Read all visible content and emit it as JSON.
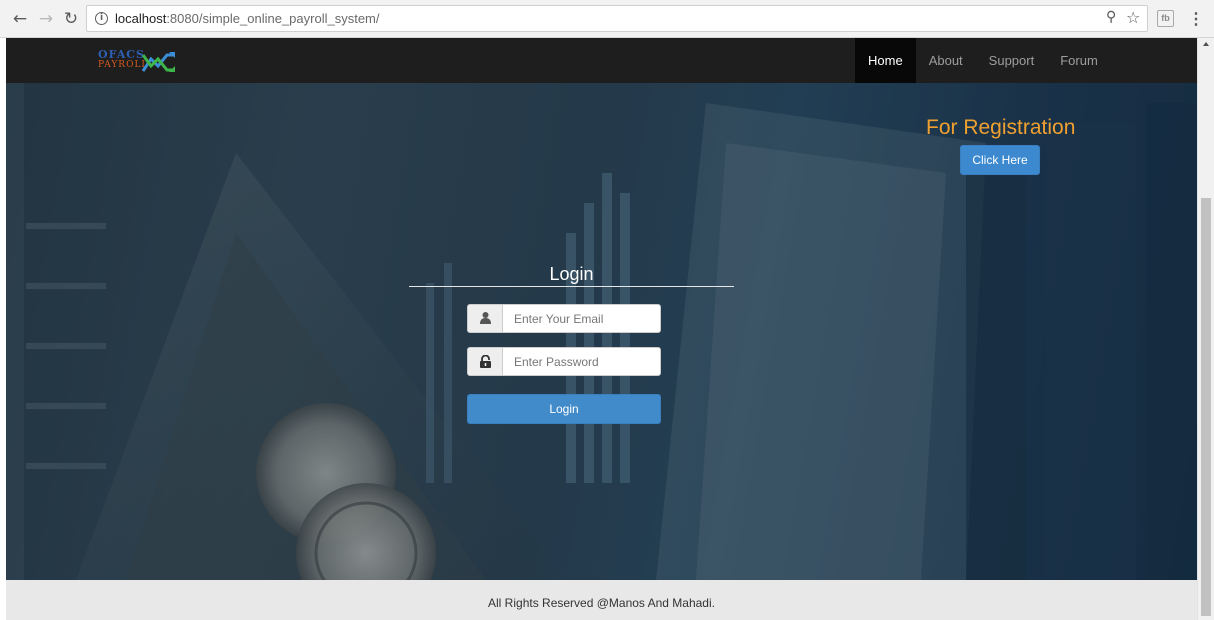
{
  "browser": {
    "url_host": "localhost",
    "url_rest": ":8080/simple_online_payroll_system/",
    "back_icon": "arrow-left-icon",
    "forward_icon": "arrow-right-icon",
    "reload_icon": "reload-icon",
    "extension_label": "fb"
  },
  "header": {
    "logo_line1": "OFACS",
    "logo_line2": "PAYROLL",
    "nav": [
      {
        "label": "Home",
        "active": true
      },
      {
        "label": "About",
        "active": false
      },
      {
        "label": "Support",
        "active": false
      },
      {
        "label": "Forum",
        "active": false
      }
    ]
  },
  "registration": {
    "title": "For Registration",
    "button_label": "Click Here"
  },
  "login": {
    "title": "Login",
    "email_placeholder": "Enter Your Email",
    "password_placeholder": "Enter Password",
    "button_label": "Login",
    "user_icon": "user-icon",
    "lock_icon": "lock-icon"
  },
  "footer": {
    "text": "All Rights Reserved @Manos And Mahadi."
  },
  "colors": {
    "navbar_bg": "#1e1e1e",
    "registration_title": "#f0a030",
    "primary_button": "#428bca",
    "footer_bg": "#e8e8e8"
  }
}
